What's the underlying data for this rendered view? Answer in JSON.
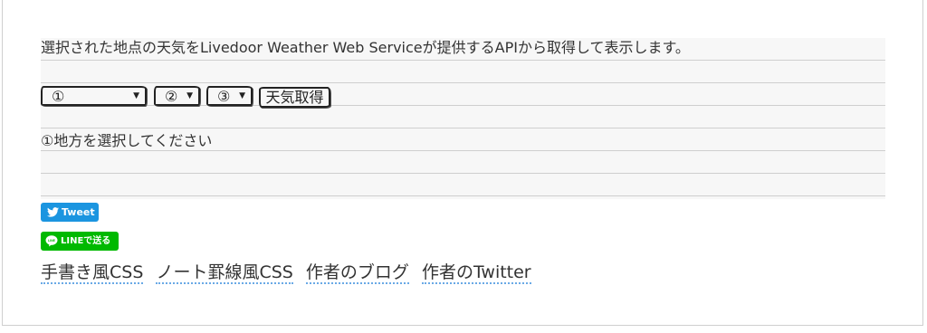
{
  "description": "選択された地点の天気をLivedoor Weather Web Serviceが提供するAPIから取得して表示します。",
  "controls": {
    "select1_value": "①",
    "select2_value": "②",
    "select3_value": "③",
    "get_weather_label": "天気取得"
  },
  "status_text": "①地方を選択してください",
  "share": {
    "tweet_label": "Tweet",
    "line_label": "LINEで送る",
    "tweet_color": "#1b95e0",
    "line_color": "#00b900"
  },
  "links": [
    {
      "label": "手書き風CSS"
    },
    {
      "label": "ノート罫線風CSS"
    },
    {
      "label": "作者のブログ"
    },
    {
      "label": "作者のTwitter"
    }
  ]
}
